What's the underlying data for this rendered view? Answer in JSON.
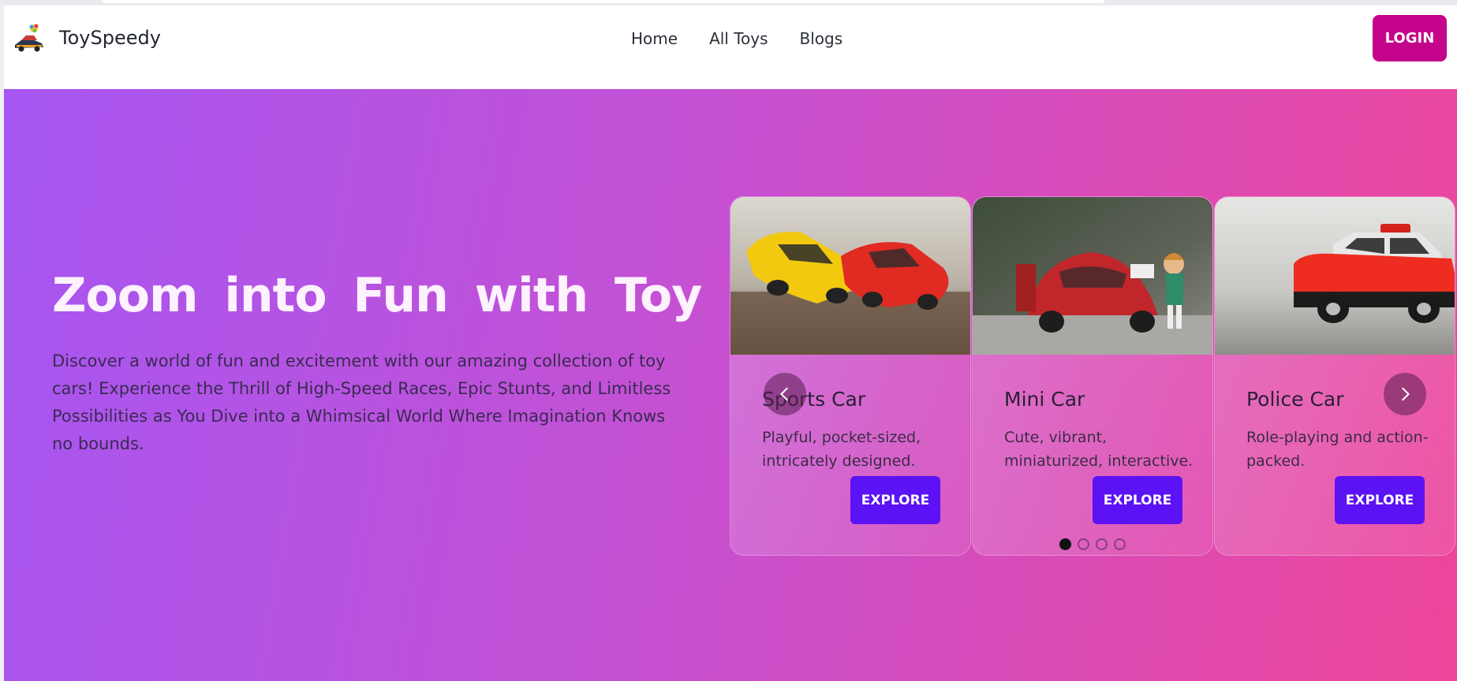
{
  "brand": {
    "name": "ToySpeedy",
    "logo_icon": "toy-car-logo-icon"
  },
  "nav": {
    "items": [
      {
        "label": "Home"
      },
      {
        "label": "All Toys"
      },
      {
        "label": "Blogs"
      }
    ]
  },
  "login_label": "LOGIN",
  "colors": {
    "login_bg": "#c4048a",
    "explore_bg": "#5b12f5",
    "hero_gradient_start": "#a656f2",
    "hero_gradient_end": "#ee469a"
  },
  "hero": {
    "title": "Zoom into Fun with Toy cars",
    "description": "Discover a world of fun and excitement with our amazing collection of toy cars! Experience the Thrill of High-Speed Races, Epic Stunts, and Limitless Possibilities as You Dive into a Whimsical World Where Imagination Knows no bounds."
  },
  "carousel": {
    "prev_icon": "chevron-left-icon",
    "next_icon": "chevron-right-icon",
    "active_dot": 1,
    "dot_count": 4,
    "cards": [
      {
        "title": "Sports Car",
        "description": "Playful, pocket-sized, intricately designed.",
        "button": "EXPLORE"
      },
      {
        "title": "Mini Car",
        "description": "Cute, vibrant, miniaturized, interactive.",
        "button": "EXPLORE"
      },
      {
        "title": "Police Car",
        "description": "Role-playing and action-packed.",
        "button": "EXPLORE"
      }
    ]
  }
}
